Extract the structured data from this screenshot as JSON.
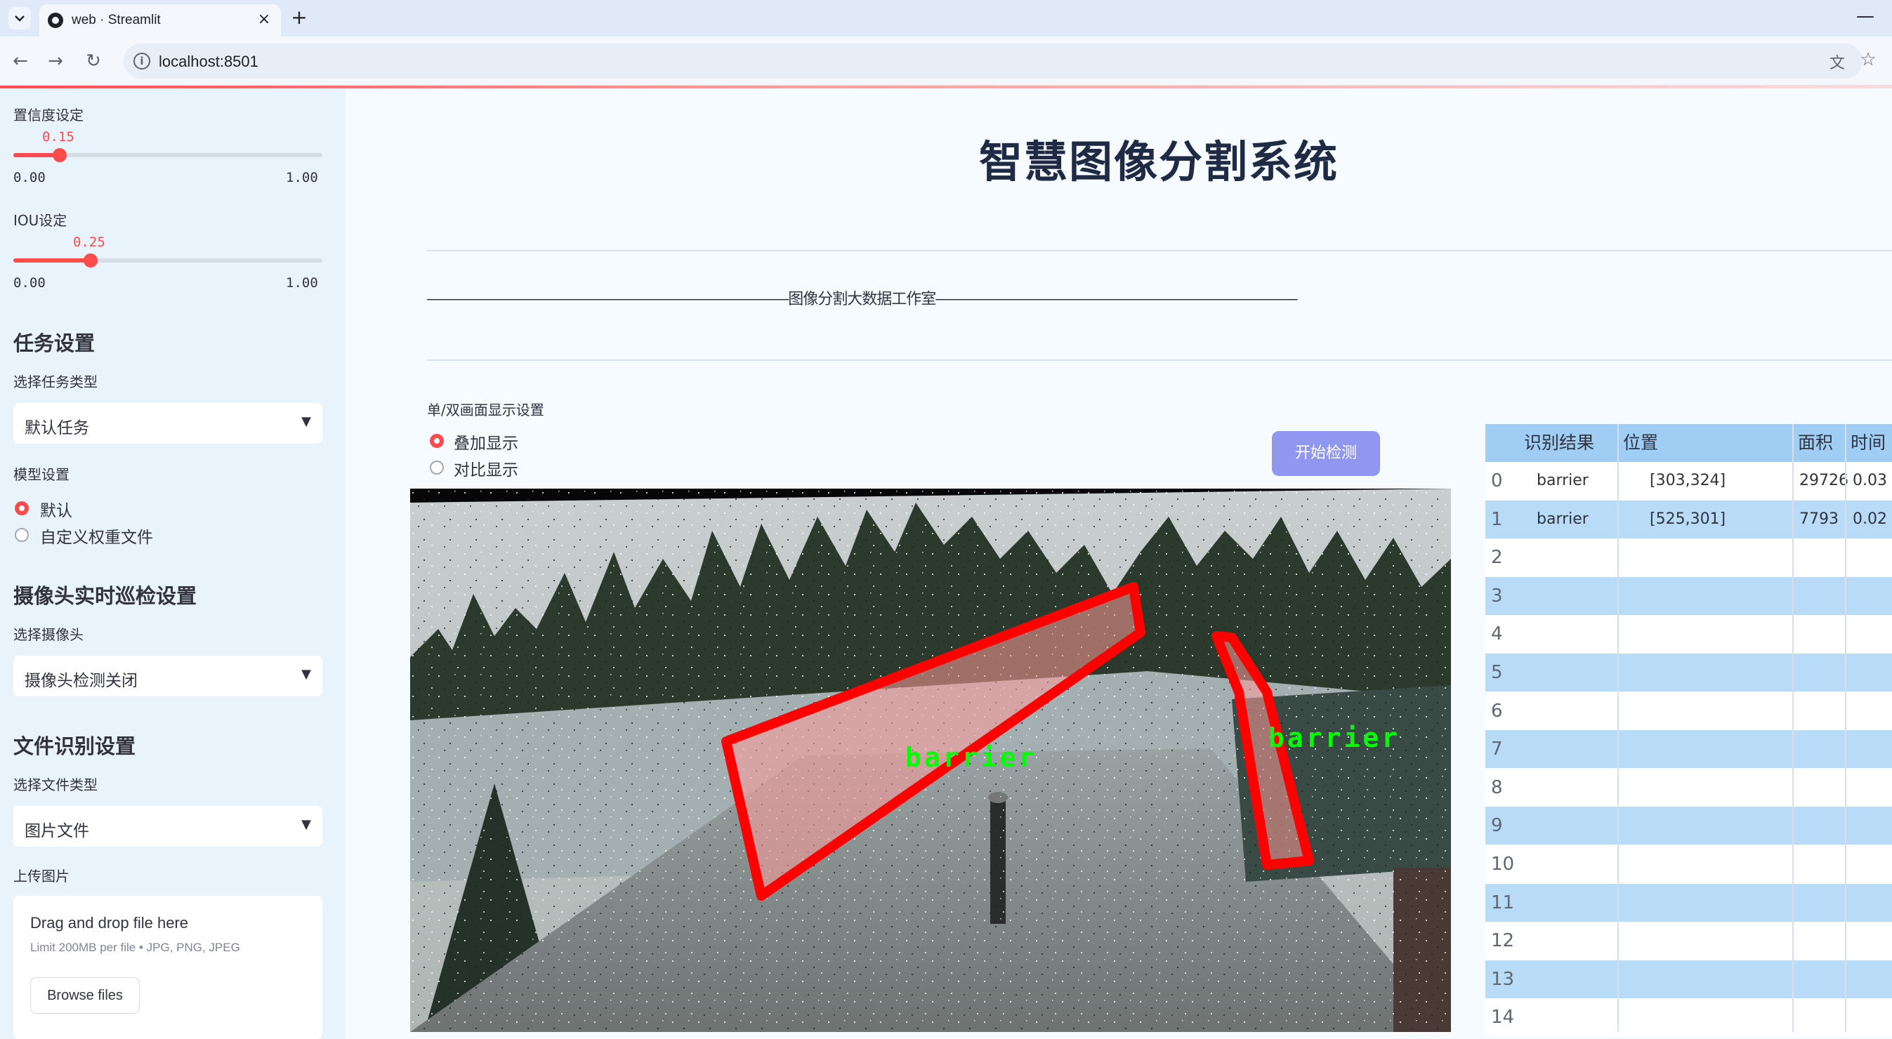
{
  "browser": {
    "tab_title": "web · Streamlit",
    "tab_close": "×",
    "new_tab": "+",
    "url": "localhost:8501",
    "minimize": "—"
  },
  "sidebar": {
    "confidence": {
      "label": "置信度设定",
      "value": "0.15",
      "value_fraction": 0.15,
      "min": "0.00",
      "max": "1.00"
    },
    "iou": {
      "label": "IOU设定",
      "value": "0.25",
      "value_fraction": 0.25,
      "min": "0.00",
      "max": "1.00"
    },
    "task_header": "任务设置",
    "task_type_label": "选择任务类型",
    "task_type_value": "默认任务",
    "model_label": "模型设置",
    "model_options": [
      "默认",
      "自定义权重文件"
    ],
    "model_selected": "默认",
    "camera_header": "摄像头实时巡检设置",
    "camera_label": "选择摄像头",
    "camera_value": "摄像头检测关闭",
    "file_header": "文件识别设置",
    "file_type_label": "选择文件类型",
    "file_type_value": "图片文件",
    "upload_label": "上传图片",
    "uploader": {
      "title": "Drag and drop file here",
      "limit": "Limit 200MB per file • JPG, PNG, JPEG",
      "button": "Browse files"
    }
  },
  "main": {
    "title": "智慧图像分割系统",
    "subtitle_line": "——————————————————————————————————————————图像分割大数据工作室——————————————————————————————————————————",
    "display_label": "单/双画面显示设置",
    "display_options": [
      "叠加显示",
      "对比显示"
    ],
    "display_selected": "叠加显示",
    "start_button": "开始检测",
    "detection_labels": [
      "barrier",
      "barrier"
    ]
  },
  "table": {
    "columns": [
      "",
      "识别结果",
      "位置",
      "面积",
      "时间"
    ],
    "rows": [
      {
        "index": "0",
        "result": "barrier",
        "position": "[303,324]",
        "area": "29726",
        "time": "0.03"
      },
      {
        "index": "1",
        "result": "barrier",
        "position": "[525,301]",
        "area": "7793",
        "time": "0.02"
      },
      {
        "index": "2"
      },
      {
        "index": "3"
      },
      {
        "index": "4"
      },
      {
        "index": "5"
      },
      {
        "index": "6"
      },
      {
        "index": "7"
      },
      {
        "index": "8"
      },
      {
        "index": "9"
      },
      {
        "index": "10"
      },
      {
        "index": "11"
      },
      {
        "index": "12"
      },
      {
        "index": "13"
      },
      {
        "index": "14"
      }
    ]
  },
  "colors": {
    "accent": "#ff4b4b",
    "sidebar_bg": "#e9f3fc",
    "table_header": "#9fcdf4",
    "table_stripe": "#b8dbf7",
    "button": "#8f97f0",
    "detection": "#ff0000",
    "label_green": "#00ff00"
  }
}
